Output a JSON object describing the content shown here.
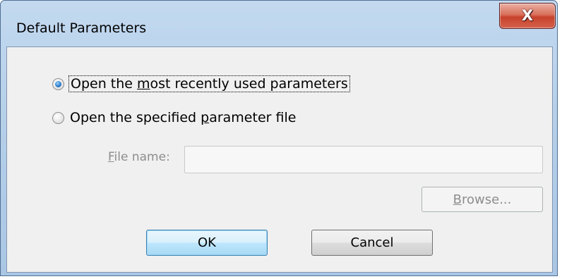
{
  "window": {
    "title": "Default Parameters",
    "close_glyph": "X",
    "close_icon": "close-icon"
  },
  "options": {
    "recent": {
      "label": "Open the most recently used parameters",
      "checked": true
    },
    "specified": {
      "label": "Open the specified parameter file",
      "checked": false
    }
  },
  "file": {
    "label": "File name:",
    "value": "",
    "enabled": false
  },
  "buttons": {
    "browse": "Browse...",
    "ok": "OK",
    "cancel": "Cancel"
  },
  "colors": {
    "accent": "#3c7fb1",
    "close": "#c7432c",
    "titlebar": "#b5cfe9",
    "disabled_text": "#8d8d8d"
  }
}
